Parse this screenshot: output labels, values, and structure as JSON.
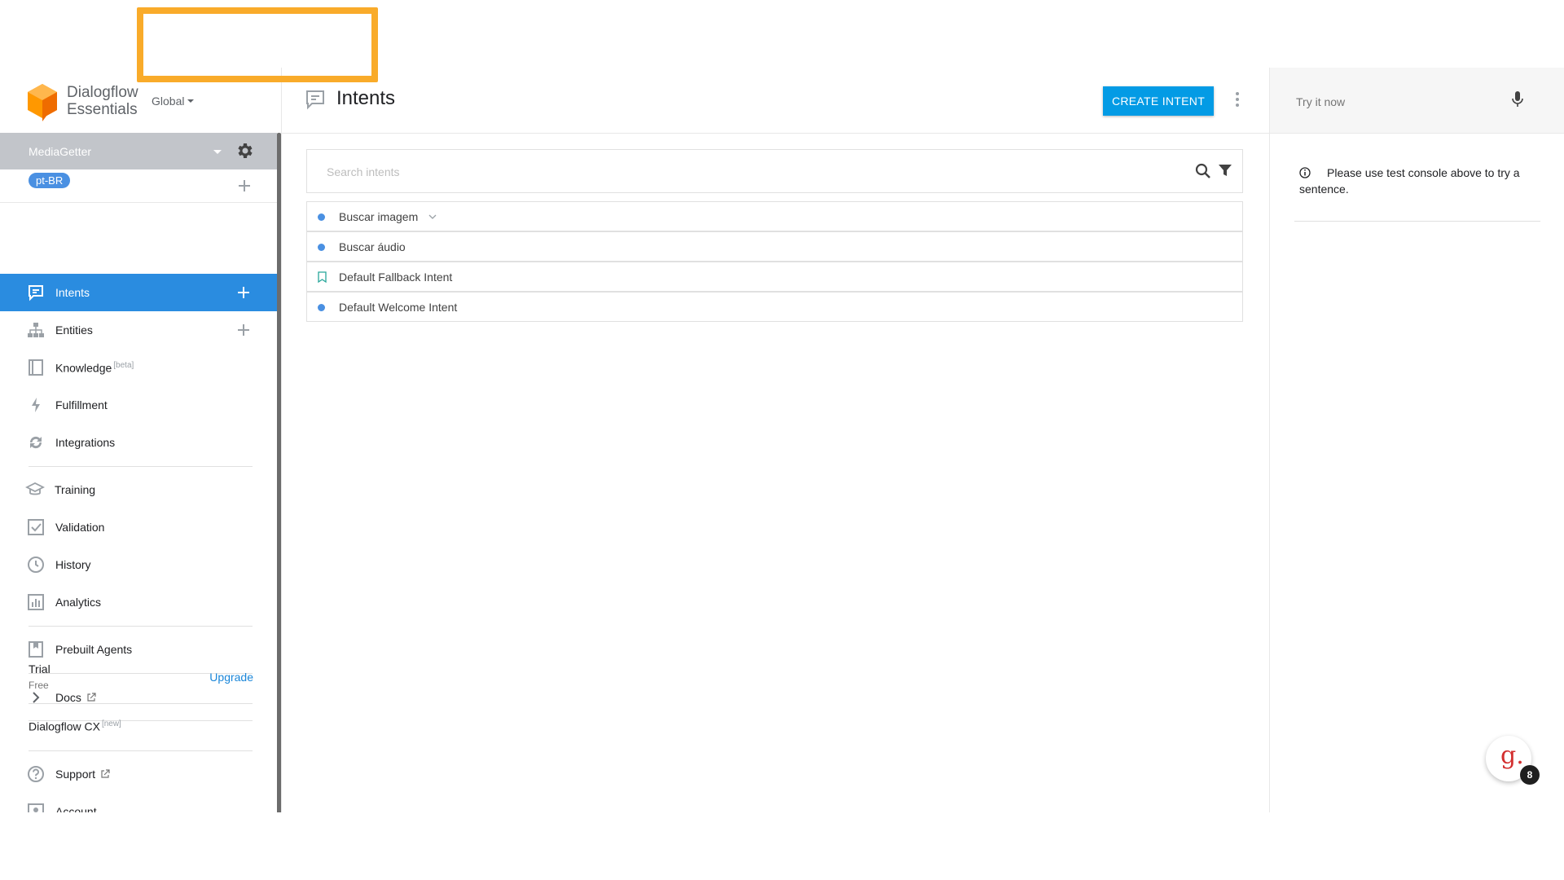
{
  "brand": {
    "name_line1": "Dialogflow",
    "name_line2": "Essentials",
    "region": "Global"
  },
  "agent": {
    "name": "MediaGetter",
    "language": "pt-BR"
  },
  "sidebar": {
    "items": [
      {
        "label": "Intents",
        "icon": "chat-bubble-icon",
        "active": true
      },
      {
        "label": "Entities",
        "icon": "hierarchy-icon"
      },
      {
        "label": "Knowledge",
        "sup": "[beta]",
        "icon": "book-icon"
      },
      {
        "label": "Fulfillment",
        "icon": "bolt-icon"
      },
      {
        "label": "Integrations",
        "icon": "sync-icon"
      },
      {
        "label": "Training",
        "icon": "graduation-cap-icon"
      },
      {
        "label": "Validation",
        "icon": "checkbox-icon"
      },
      {
        "label": "History",
        "icon": "clock-icon"
      },
      {
        "label": "Analytics",
        "icon": "bar-chart-icon"
      },
      {
        "label": "Prebuilt Agents",
        "icon": "bookmark-book-icon"
      },
      {
        "label": "Docs",
        "icon": "chevron-right-icon"
      },
      {
        "label": "Support",
        "icon": "help-circle-icon"
      },
      {
        "label": "Account",
        "icon": "account-icon"
      }
    ],
    "trial": {
      "label": "Trial",
      "plan": "Free",
      "upgrade": "Upgrade"
    },
    "cx": {
      "label": "Dialogflow CX",
      "sup": "[new]"
    }
  },
  "main": {
    "title": "Intents",
    "create_button": "CREATE INTENT",
    "search": {
      "placeholder": "Search intents"
    },
    "intents": [
      {
        "name": "Buscar imagem",
        "marker": "dot",
        "has_children": true
      },
      {
        "name": "Buscar áudio",
        "marker": "dot"
      },
      {
        "name": "Default Fallback Intent",
        "marker": "bookmark"
      },
      {
        "name": "Default Welcome Intent",
        "marker": "dot"
      }
    ]
  },
  "right_panel": {
    "try_placeholder": "Try it now",
    "info": "Please use test console above to try a sentence."
  },
  "widget": {
    "letter": "g.",
    "badge": "8"
  },
  "colors": {
    "primary": "#2a8ce0",
    "button": "#039be5",
    "highlight": "#f9ab2a",
    "logo": "#ff9800"
  }
}
